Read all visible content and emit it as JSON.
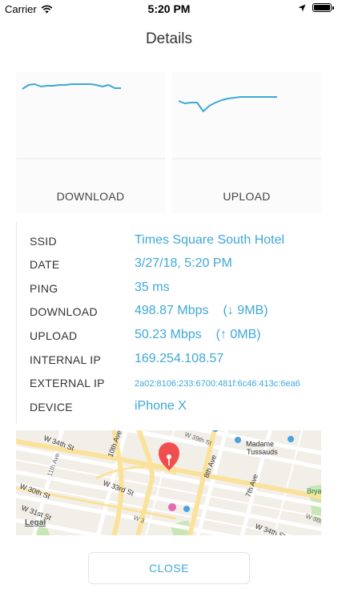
{
  "status_bar": {
    "carrier": "Carrier",
    "time": "5:20 PM"
  },
  "header": {
    "title": "Details"
  },
  "charts": [
    {
      "type": "line",
      "label": "DOWNLOAD",
      "x": [
        0,
        1,
        2,
        3,
        4,
        5,
        6,
        7,
        8,
        9,
        10,
        11,
        12,
        13,
        14,
        15,
        16
      ],
      "values": [
        0.84,
        0.89,
        0.9,
        0.87,
        0.88,
        0.88,
        0.89,
        0.89,
        0.9,
        0.9,
        0.9,
        0.9,
        0.89,
        0.87,
        0.89,
        0.85,
        0.85
      ],
      "ylim": [
        0,
        1
      ],
      "color": "#3ea8d8"
    },
    {
      "type": "line",
      "label": "UPLOAD",
      "x": [
        0,
        1,
        2,
        3,
        4,
        5,
        6,
        7,
        8,
        9,
        10,
        11,
        12,
        13,
        14,
        15,
        16
      ],
      "values": [
        0.69,
        0.66,
        0.67,
        0.67,
        0.56,
        0.63,
        0.67,
        0.7,
        0.72,
        0.73,
        0.74,
        0.74,
        0.74,
        0.74,
        0.74,
        0.74,
        0.74
      ],
      "ylim": [
        0,
        1
      ],
      "color": "#3ea8d8"
    }
  ],
  "info": [
    {
      "key": "SSID",
      "value": "Times Square South Hotel"
    },
    {
      "key": "DATE",
      "value": "3/27/18, 5:20 PM"
    },
    {
      "key": "PING",
      "value": "35 ms"
    },
    {
      "key": "DOWNLOAD",
      "value": "498.87 Mbps",
      "extra": "(↓ 9MB)"
    },
    {
      "key": "UPLOAD",
      "value": "50.23 Mbps",
      "extra": "(↑ 0MB)"
    },
    {
      "key": "INTERNAL IP",
      "value": "169.254.108.57"
    },
    {
      "key": "EXTERNAL IP",
      "value": "2a02:8106:233:6700:481f:6c46:413c:6ea6"
    },
    {
      "key": "DEVICE",
      "value": "iPhone X"
    }
  ],
  "map": {
    "labels": {
      "w34_left": "W 34th St",
      "w34_right": "W 34th St",
      "w33": "W 33rd St",
      "w30": "W 30th St",
      "w31": "W 31st St",
      "w39": "W 39th St",
      "w38": "W 38th",
      "w3x": "W 3",
      "ave10": "10th Ave",
      "ave11": "11th Ave",
      "ave8": "8th Ave",
      "ave7": "7th Ave",
      "madame": "Madame",
      "tussauds": "Tussauds",
      "bryant": "Brya"
    },
    "legal": "Legal",
    "colors": {
      "road": "#fbe9a0",
      "pin": "#f04e4e",
      "water": "#a7d2f0",
      "park": "#c8e6b6"
    }
  },
  "close_button": {
    "label": "CLOSE"
  }
}
